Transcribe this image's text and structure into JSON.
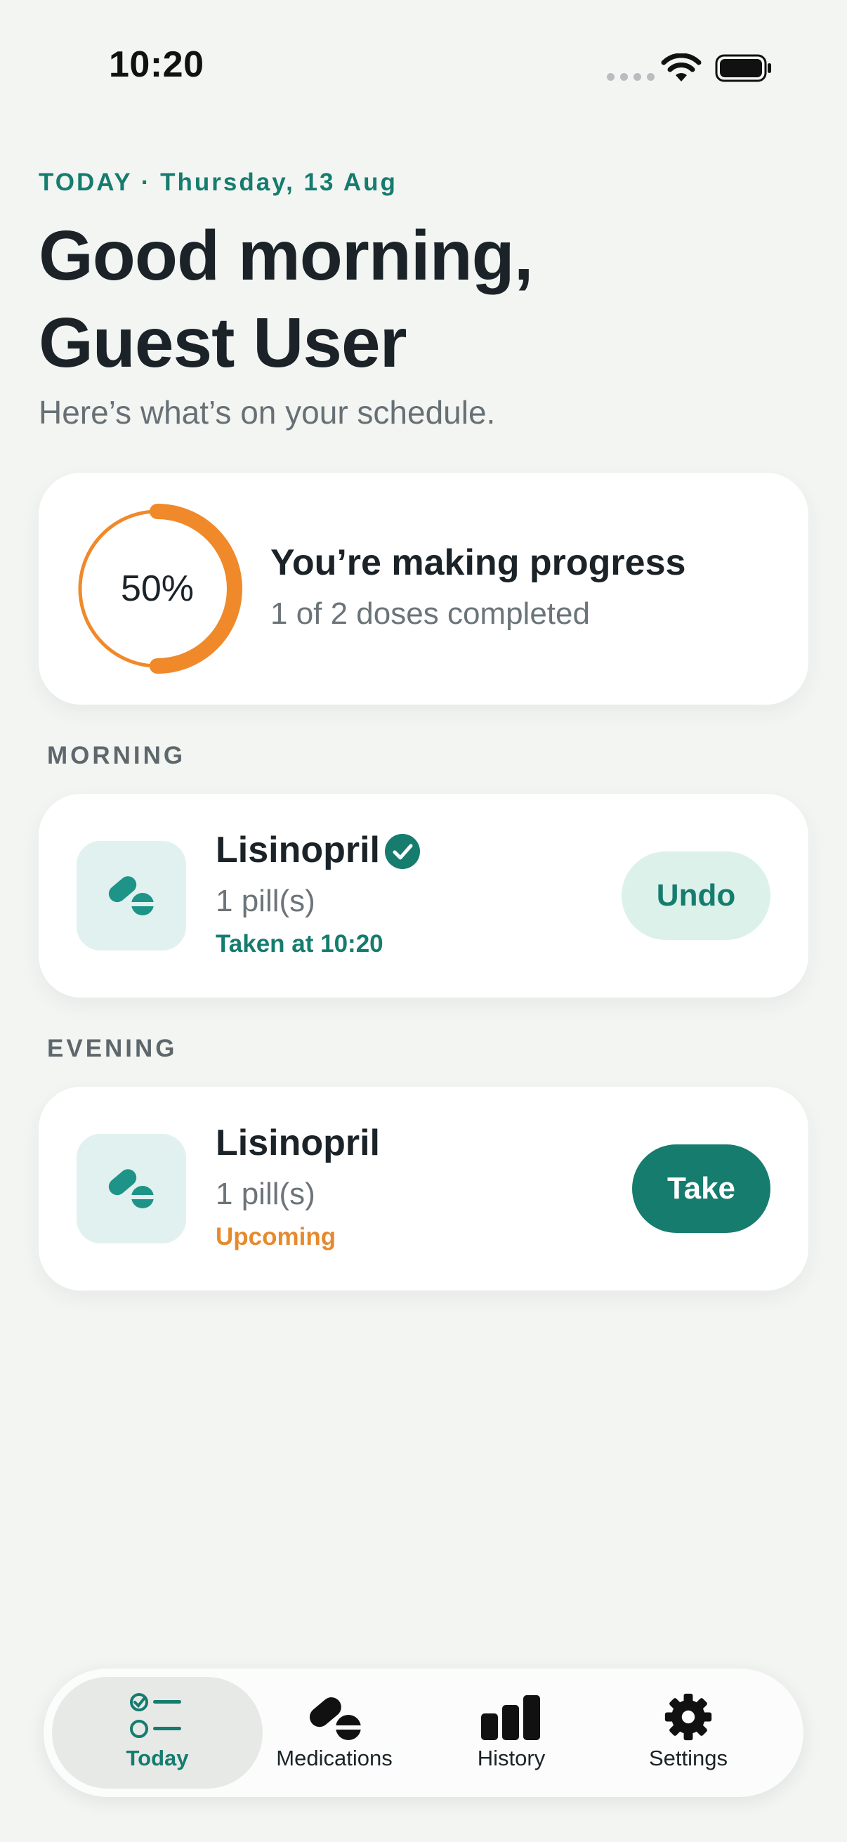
{
  "status_bar": {
    "time": "10:20"
  },
  "header": {
    "date_line": "TODAY · Thursday, 13 Aug",
    "greeting_line1": "Good morning,",
    "greeting_line2": "Guest User",
    "subtitle": "Here’s what’s on your schedule."
  },
  "progress": {
    "percent_label": "50%",
    "fraction_completed": 0.5,
    "title": "You’re making progress",
    "subtitle": "1 of 2 doses completed"
  },
  "sections": [
    {
      "label": "MORNING",
      "dose": {
        "name": "Lisinopril",
        "amount": "1 pill(s)",
        "status": "Taken at 10:20",
        "action": "Undo",
        "taken": true
      }
    },
    {
      "label": "EVENING",
      "dose": {
        "name": "Lisinopril",
        "amount": "1 pill(s)",
        "status": "Upcoming",
        "action": "Take",
        "taken": false
      }
    }
  ],
  "tabs": [
    {
      "label": "Today",
      "icon": "checklist-icon",
      "active": true
    },
    {
      "label": "Medications",
      "icon": "pills-icon",
      "active": false
    },
    {
      "label": "History",
      "icon": "bar-chart-icon",
      "active": false
    },
    {
      "label": "Settings",
      "icon": "gear-icon",
      "active": false
    }
  ],
  "colors": {
    "accent": "#157C6E",
    "progress": "#F0892A",
    "upcoming": "#E68A2E",
    "background": "#F3F5F3"
  }
}
